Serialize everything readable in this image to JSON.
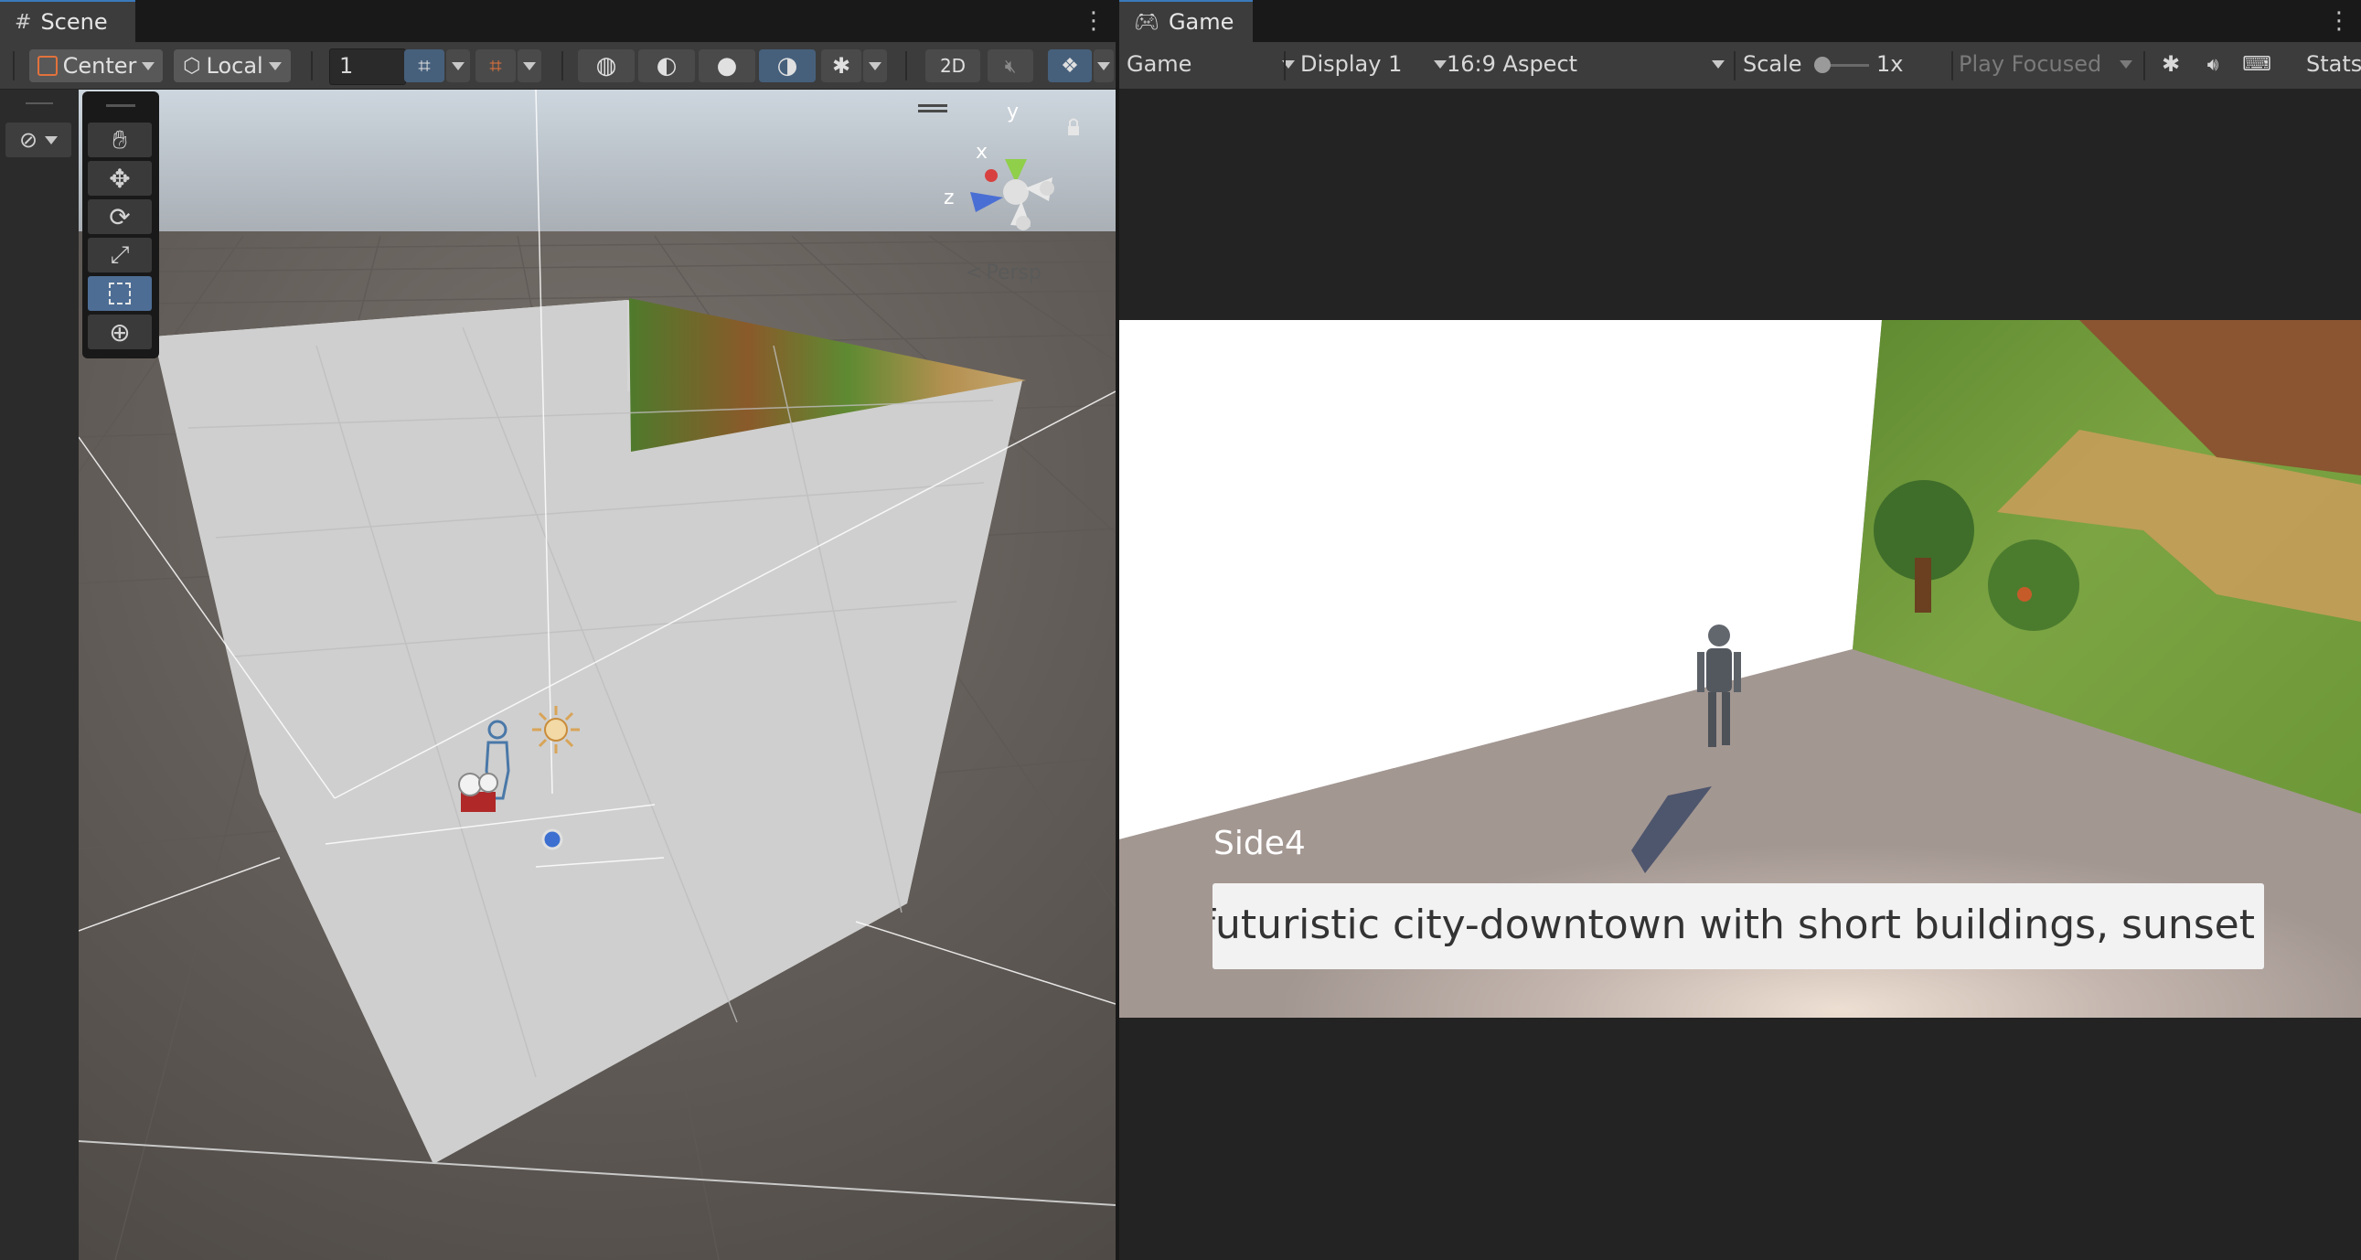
{
  "scene_panel": {
    "tab_label": "Scene",
    "toolbar": {
      "pivot_label": "Center",
      "space_label": "Local",
      "grid_size_value": "1",
      "mode_2d_label": "2D"
    },
    "gizmo": {
      "axis_y": "y",
      "axis_x": "x",
      "axis_z": "z",
      "projection_label": "Persp"
    }
  },
  "game_panel": {
    "tab_label": "Game",
    "toolbar": {
      "view_label": "Game",
      "display_label": "Display 1",
      "aspect_label": "16:9 Aspect",
      "scale_label": "Scale",
      "scale_value": "1x",
      "play_mode_label": "Play Focused",
      "stats_label": "Stats"
    },
    "viewport": {
      "side_label": "Side4",
      "prompt_text": "futuristic city-downtown with short buildings, sunset"
    }
  },
  "colors": {
    "accent": "#3a79bb",
    "active_toggle": "#46607c"
  }
}
